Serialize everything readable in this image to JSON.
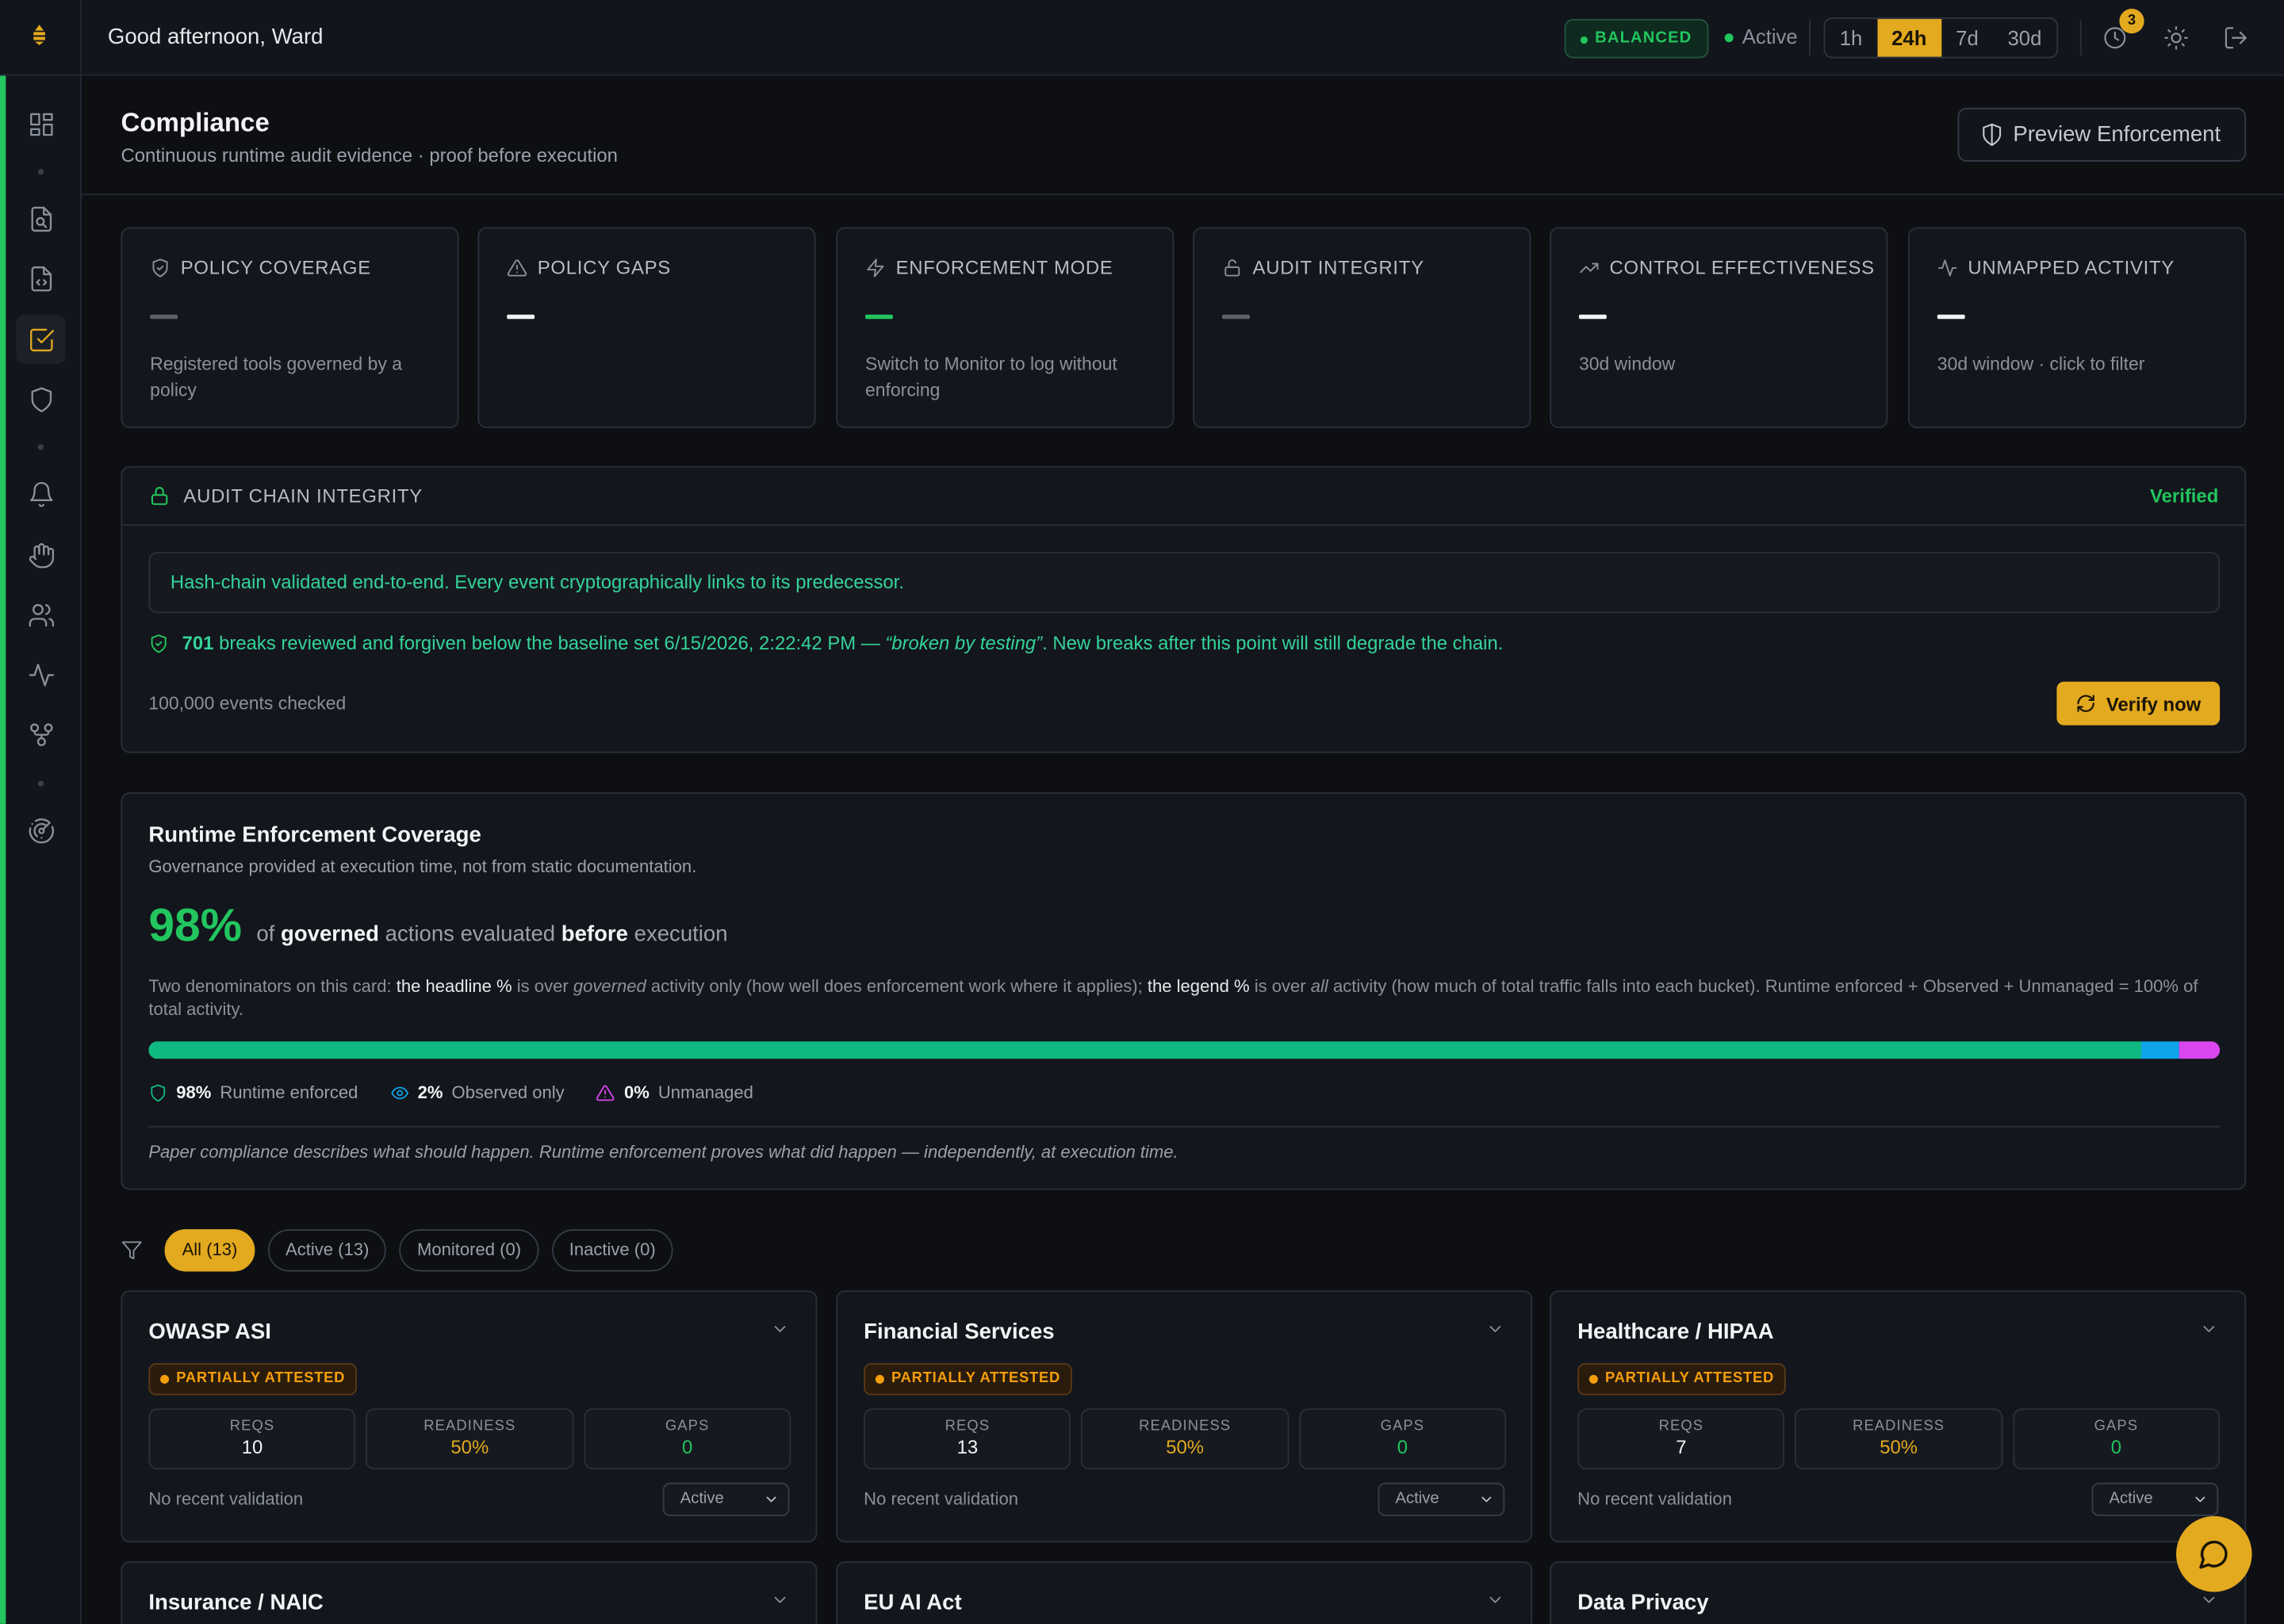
{
  "topbar": {
    "greeting": "Good afternoon, Ward",
    "mode_badge": "BALANCED",
    "status": "Active",
    "time_ranges": [
      "1h",
      "24h",
      "7d",
      "30d"
    ],
    "selected_range": "24h",
    "notification_count": "3"
  },
  "page": {
    "title": "Compliance",
    "subtitle": "Continuous runtime audit evidence · proof before execution",
    "preview_button": "Preview Enforcement"
  },
  "stats": [
    {
      "label": "POLICY COVERAGE",
      "icon": "shield-check-icon",
      "value": "—",
      "value_color": "#5b616b",
      "desc": "Registered tools governed by a policy"
    },
    {
      "label": "POLICY GAPS",
      "icon": "alert-triangle-icon",
      "value": "—",
      "value_color": "#f2f3f5",
      "desc": ""
    },
    {
      "label": "ENFORCEMENT MODE",
      "icon": "zap-icon",
      "value": "—",
      "value_color": "#22c55e",
      "desc": "Switch to Monitor to log without enforcing"
    },
    {
      "label": "AUDIT INTEGRITY",
      "icon": "unlock-icon",
      "value": "—",
      "value_color": "#5b616b",
      "desc": ""
    },
    {
      "label": "CONTROL EFFECTIVENESS",
      "icon": "trending-up-icon",
      "value": "—",
      "value_color": "#f2f3f5",
      "desc": "30d window"
    },
    {
      "label": "UNMAPPED ACTIVITY",
      "icon": "activity-icon",
      "value": "—",
      "value_color": "#f2f3f5",
      "desc": "30d window · click to filter"
    }
  ],
  "audit": {
    "title": "AUDIT CHAIN INTEGRITY",
    "status": "Verified",
    "message": "Hash-chain validated end-to-end. Every event cryptographically links to its predecessor.",
    "breaks_count": "701",
    "breaks_text1": "breaks reviewed and forgiven below the baseline set 6/15/2026, 2:22:42 PM —",
    "breaks_reason": "“broken by testing”",
    "breaks_text2": ". New breaks after this point will still degrade the chain.",
    "events_checked": "100,000 events checked",
    "verify_button": "Verify now"
  },
  "coverage": {
    "title": "Runtime Enforcement Coverage",
    "subtitle": "Governance provided at execution time, not from static documentation.",
    "headline_pct": "98%",
    "headline_of": "of",
    "headline_governed": "governed",
    "headline_mid": "actions evaluated",
    "headline_before": "before",
    "headline_end": "execution",
    "expl_1": "Two denominators on this card:",
    "expl_2": "the headline %",
    "expl_3": "is over",
    "expl_4": "governed",
    "expl_5": "activity only (how well does enforcement work where it applies);",
    "expl_6": "the legend %",
    "expl_7": "is over",
    "expl_8": "all",
    "expl_9": "activity (how much of total traffic falls into each bucket). Runtime enforced + Observed + Unmanaged = 100% of total activity.",
    "segments": [
      {
        "label": "Runtime enforced",
        "pct": "98%",
        "value": 96.2,
        "color": "#10b981",
        "icon": "shield-icon"
      },
      {
        "label": "Observed only",
        "pct": "2%",
        "value": 1.8,
        "color": "#0ea5e9",
        "icon": "eye-icon"
      },
      {
        "label": "Unmanaged",
        "pct": "0%",
        "value": 2.0,
        "color": "#d946ef",
        "icon": "alert-triangle-icon"
      }
    ],
    "footnote": "Paper compliance describes what should happen. Runtime enforcement proves what did happen — independently, at execution time."
  },
  "filters": [
    "All (13)",
    "Active (13)",
    "Monitored (0)",
    "Inactive (0)"
  ],
  "frameworks": [
    {
      "name": "OWASP ASI",
      "status": "PARTIALLY ATTESTED",
      "reqs": "10",
      "readiness": "50%",
      "gaps": "0",
      "validation": "No recent validation",
      "select": "Active"
    },
    {
      "name": "Financial Services",
      "status": "PARTIALLY ATTESTED",
      "reqs": "13",
      "readiness": "50%",
      "gaps": "0",
      "validation": "No recent validation",
      "select": "Active"
    },
    {
      "name": "Healthcare / HIPAA",
      "status": "PARTIALLY ATTESTED",
      "reqs": "7",
      "readiness": "50%",
      "gaps": "0",
      "validation": "No recent validation",
      "select": "Active"
    },
    {
      "name": "Insurance / NAIC"
    },
    {
      "name": "EU AI Act"
    },
    {
      "name": "Data Privacy"
    }
  ],
  "framework_labels": {
    "reqs": "REQS",
    "readiness": "READINESS",
    "gaps": "GAPS"
  },
  "theme": {
    "accent": "#e3a91f",
    "success": "#22c55e",
    "warning": "#f59e0b"
  }
}
